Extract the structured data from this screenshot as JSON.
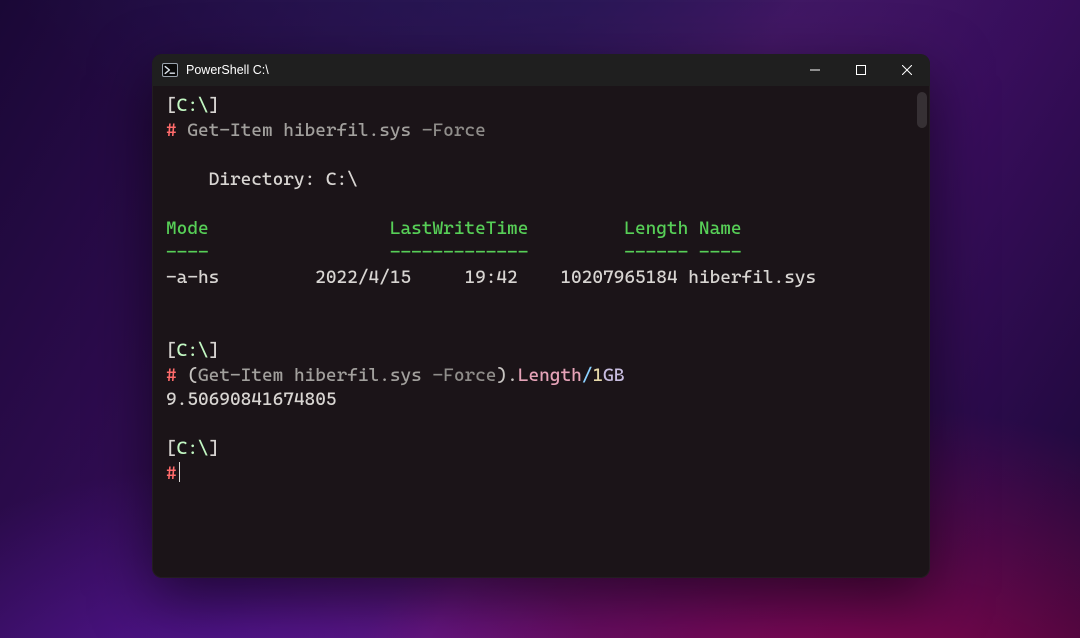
{
  "window": {
    "title": "PowerShell C:\\"
  },
  "session": {
    "block1": {
      "cwd_open": "[",
      "cwd": "C:\\",
      "cwd_close": "]",
      "prompt": "#",
      "cmd_name": "Get-Item",
      "cmd_arg": "hiberfil.sys",
      "cmd_flag": "-Force",
      "dir_label": "Directory:",
      "dir_value": "C:\\",
      "header_mode": "Mode",
      "header_lwt": "LastWriteTime",
      "header_len": "Length",
      "header_name": "Name",
      "underline_mode": "----",
      "underline_lwt": "-------------",
      "underline_len": "------",
      "underline_name": "----",
      "row_mode": "-a-hs",
      "row_date": "2022/4/15",
      "row_time": "19:42",
      "row_length": "10207965184",
      "row_name": "hiberfil.sys"
    },
    "block2": {
      "cwd_open": "[",
      "cwd": "C:\\",
      "cwd_close": "]",
      "prompt": "#",
      "paren_open": "(",
      "cmd_name": "Get-Item",
      "cmd_arg": "hiberfil.sys",
      "cmd_flag": "-Force",
      "paren_close": ")",
      "dot": ".",
      "prop": "Length",
      "op": "/",
      "num": "1",
      "unit": "GB",
      "result": "9.50690841674805"
    },
    "block3": {
      "cwd_open": "[",
      "cwd": "C:\\",
      "cwd_close": "]",
      "prompt": "#"
    }
  }
}
